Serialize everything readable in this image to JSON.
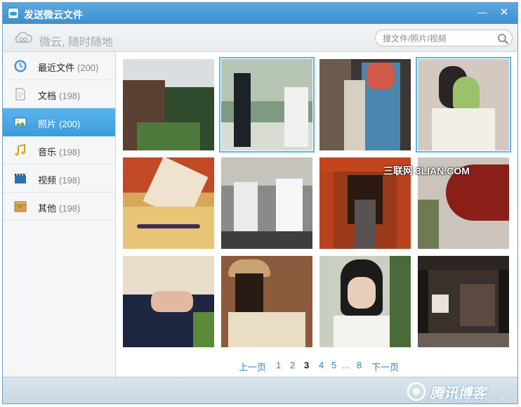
{
  "window": {
    "title": "发送微云文件",
    "minimize_label": "—",
    "close_label": "✕"
  },
  "toolbar": {
    "slogan": "微云, 随时随地",
    "search_placeholder": "搜文件/照片/视频"
  },
  "sidebar": {
    "items": [
      {
        "label": "最近文件",
        "count": "(200)",
        "icon": "clock-icon"
      },
      {
        "label": "文档",
        "count": "(198)",
        "icon": "document-icon"
      },
      {
        "label": "照片",
        "count": "(200)",
        "icon": "image-icon"
      },
      {
        "label": "音乐",
        "count": "(198)",
        "icon": "music-note-icon"
      },
      {
        "label": "视频",
        "count": "(198)",
        "icon": "film-icon"
      },
      {
        "label": "其他",
        "count": "(198)",
        "icon": "box-icon"
      }
    ]
  },
  "photo_overlay_text": "三联网 3LIAN.COM",
  "pager": {
    "prev_label": "上一页",
    "pages": [
      "1",
      "2",
      "3",
      "4",
      "5"
    ],
    "current_page": "3",
    "ellipsis": "...",
    "last_page": "8",
    "next_label": "下一页"
  },
  "watermark": {
    "text": "腾讯博客",
    "sub": "BLOG.QQ.COM"
  },
  "colors": {
    "accent": "#3b9ddd",
    "title_bar": "#4a9bd8",
    "link": "#2f7fc5",
    "selection_border": "#59b7ea"
  }
}
